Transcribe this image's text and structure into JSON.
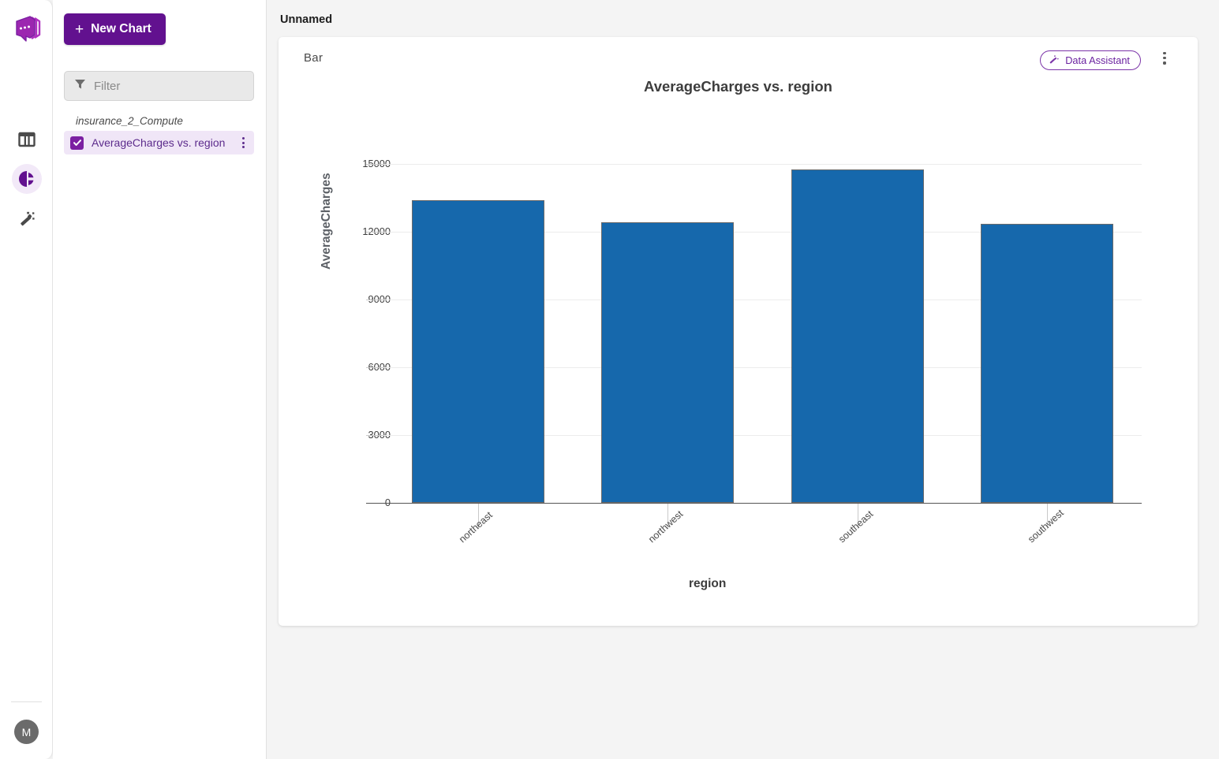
{
  "app": {
    "logo_icon": "app-logo-icon",
    "avatar_initial": "M"
  },
  "rail": {
    "items": [
      {
        "icon": "table-icon",
        "name": "rail-item-table",
        "active": false
      },
      {
        "icon": "pie-chart-icon",
        "name": "rail-item-charts",
        "active": true
      },
      {
        "icon": "magic-wand-icon",
        "name": "rail-item-assistant",
        "active": false
      }
    ]
  },
  "sidebar": {
    "new_chart_label": "New Chart",
    "new_chart_plus": "+",
    "filter_placeholder": "Filter",
    "filter_value": "",
    "filter_icon": "funnel-icon",
    "group_label": "insurance_2_Compute",
    "items": [
      {
        "label": "AverageCharges vs. region",
        "checked": true
      }
    ]
  },
  "header": {
    "title": "Unnamed"
  },
  "card": {
    "chart_type": "Bar",
    "assistant_label": "Data Assistant",
    "assistant_icon": "magic-wand-icon",
    "menu_icon": "kebab-menu-icon"
  },
  "colors": {
    "brand_purple": "#62118f",
    "accent_purple": "#7b1fa2",
    "bar_blue": "#1668ac",
    "canvas": "#f4f4f4"
  },
  "chart_data": {
    "type": "bar",
    "title": "AverageCharges vs. region",
    "xlabel": "region",
    "ylabel": "AverageCharges",
    "categories": [
      "northeast",
      "northwest",
      "southeast",
      "southwest"
    ],
    "values": [
      13406,
      12418,
      14735,
      12347
    ],
    "ylim": [
      0,
      15900
    ],
    "yticks": [
      0,
      3000,
      6000,
      9000,
      12000,
      15000
    ],
    "ytick_labels": [
      "0",
      "3000",
      "6000",
      "9000",
      "12000",
      "15000"
    ],
    "grid": true,
    "legend": false,
    "bar_color": "#1668ac",
    "xtick_rotation": -42
  }
}
